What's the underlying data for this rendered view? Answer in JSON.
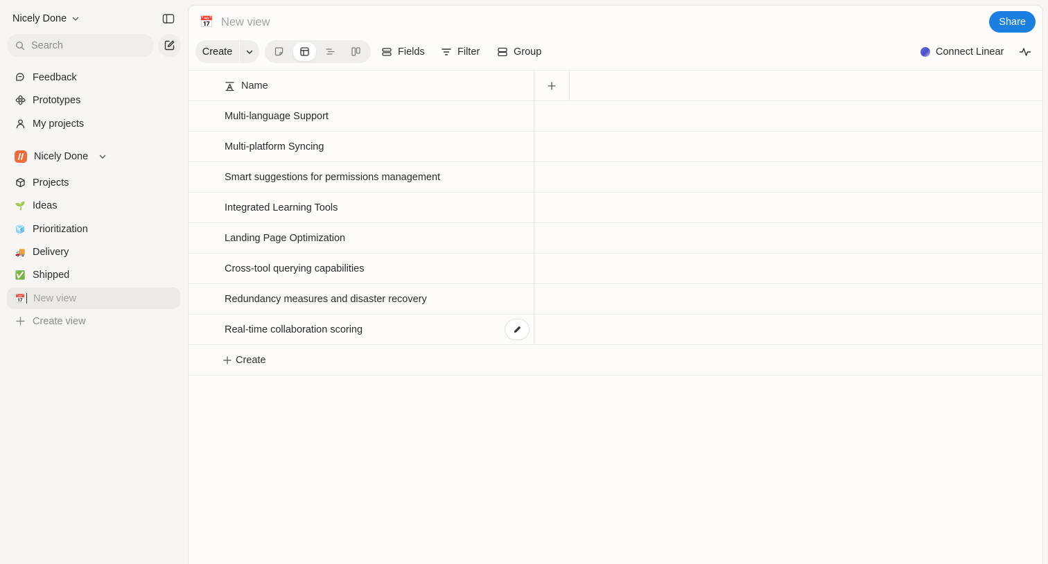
{
  "workspace": {
    "name": "Nicely Done"
  },
  "search": {
    "placeholder": "Search"
  },
  "nav_top": [
    {
      "label": "Feedback",
      "icon": "feedback-icon"
    },
    {
      "label": "Prototypes",
      "icon": "prototypes-icon"
    },
    {
      "label": "My projects",
      "icon": "person-icon"
    }
  ],
  "team": {
    "name": "Nicely Done"
  },
  "nav_team": [
    {
      "label": "Projects",
      "icon": "cube-icon"
    },
    {
      "label": "Ideas",
      "icon": "🌱"
    },
    {
      "label": "Prioritization",
      "icon": "🧊"
    },
    {
      "label": "Delivery",
      "icon": "🚚"
    },
    {
      "label": "Shipped",
      "icon": "✅"
    }
  ],
  "new_view_placeholder": "New view",
  "create_view_label": "Create view",
  "view": {
    "title": "New view",
    "title_icon": "📅"
  },
  "share_label": "Share",
  "toolbar": {
    "create_label": "Create",
    "fields_label": "Fields",
    "filter_label": "Filter",
    "group_label": "Group",
    "connect_label": "Connect Linear"
  },
  "table": {
    "column_name": "Name",
    "rows": [
      "Multi-language Support",
      "Multi-platform Syncing",
      "Smart suggestions for permissions management",
      "Integrated Learning Tools",
      "Landing Page Optimization",
      "Cross-tool querying capabilities",
      "Redundancy measures and disaster recovery",
      "Real-time collaboration scoring"
    ],
    "create_label": "Create"
  },
  "colors": {
    "accent": "#1a7fe0",
    "logo": "#f06d3a"
  }
}
